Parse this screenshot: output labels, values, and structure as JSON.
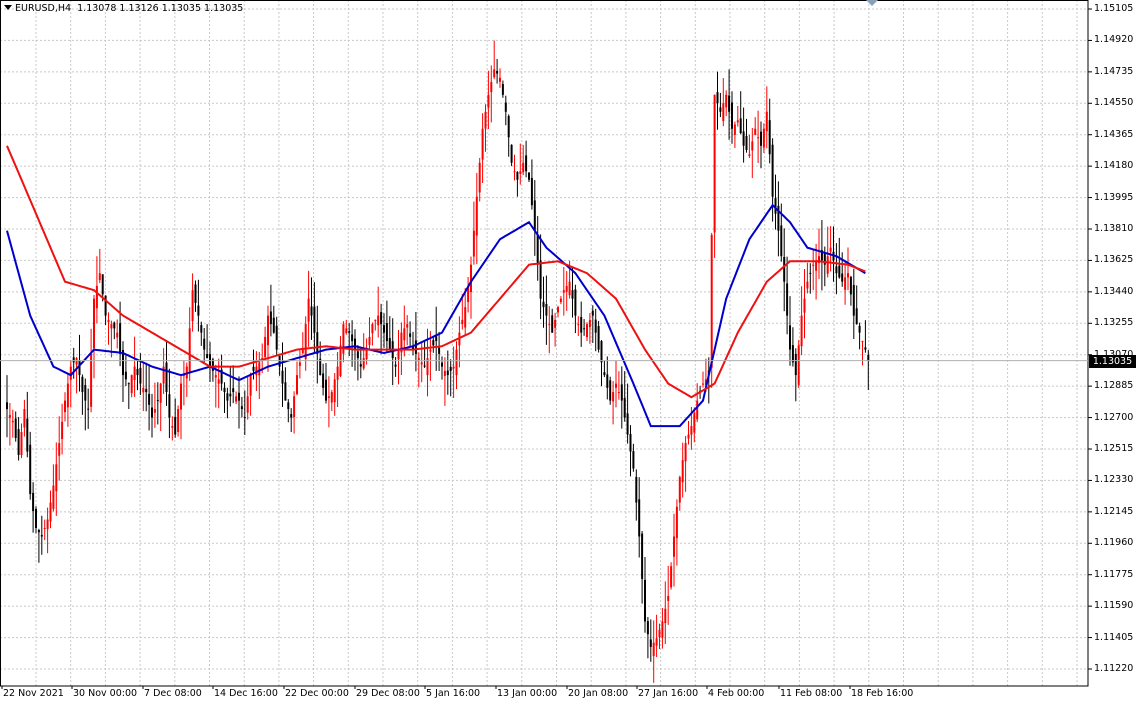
{
  "header": {
    "symbol": "EURUSD,H4",
    "prices": "1.13078 1.13126 1.13035 1.13035"
  },
  "price_axis": {
    "labels": [
      "1.15105",
      "1.14920",
      "1.14735",
      "1.14550",
      "1.14365",
      "1.14180",
      "1.13995",
      "1.13810",
      "1.13625",
      "1.13440",
      "1.13255",
      "1.13070",
      "1.12885",
      "1.12700",
      "1.12515",
      "1.12330",
      "1.12145",
      "1.11960",
      "1.11775",
      "1.11590",
      "1.11405",
      "1.11220"
    ],
    "current_price": "1.13035"
  },
  "time_axis": {
    "labels": [
      "22 Nov 2021",
      "30 Nov 00:00",
      "7 Dec 08:00",
      "14 Dec 16:00",
      "22 Dec 00:00",
      "29 Dec 08:00",
      "5 Jan 16:00",
      "13 Jan 00:00",
      "20 Jan 08:00",
      "27 Jan 16:00",
      "4 Feb 00:00",
      "11 Feb 08:00",
      "18 Feb 16:00"
    ]
  },
  "colors": {
    "bull_candle": "#ff0000",
    "bear_candle": "#000000",
    "fast_ma": "#0000cc",
    "slow_ma": "#ee1111",
    "grid": "#c8c8c8"
  },
  "chart_data": {
    "type": "candlestick",
    "symbol": "EURUSD",
    "timeframe": "H4",
    "ylim": [
      1.1122,
      1.15105
    ],
    "close_path": [
      [
        0,
        1.1275
      ],
      [
        2,
        1.1268
      ],
      [
        4,
        1.1248
      ],
      [
        6,
        1.1275
      ],
      [
        8,
        1.1225
      ],
      [
        10,
        1.1205
      ],
      [
        12,
        1.12
      ],
      [
        14,
        1.121
      ],
      [
        16,
        1.123
      ],
      [
        18,
        1.1255
      ],
      [
        20,
        1.128
      ],
      [
        22,
        1.13
      ],
      [
        24,
        1.1305
      ],
      [
        26,
        1.1285
      ],
      [
        28,
        1.1275
      ],
      [
        30,
        1.134
      ],
      [
        32,
        1.1355
      ],
      [
        34,
        1.133
      ],
      [
        36,
        1.1325
      ],
      [
        38,
        1.132
      ],
      [
        40,
        1.1295
      ],
      [
        42,
        1.129
      ],
      [
        44,
        1.13
      ],
      [
        46,
        1.129
      ],
      [
        48,
        1.1285
      ],
      [
        50,
        1.127
      ],
      [
        52,
        1.128
      ],
      [
        54,
        1.13
      ],
      [
        56,
        1.127
      ],
      [
        58,
        1.126
      ],
      [
        60,
        1.129
      ],
      [
        62,
        1.13
      ],
      [
        64,
        1.1345
      ],
      [
        66,
        1.133
      ],
      [
        68,
        1.131
      ],
      [
        70,
        1.13
      ],
      [
        72,
        1.1295
      ],
      [
        74,
        1.129
      ],
      [
        76,
        1.128
      ],
      [
        78,
        1.1285
      ],
      [
        80,
        1.128
      ],
      [
        82,
        1.127
      ],
      [
        84,
        1.1295
      ],
      [
        86,
        1.13
      ],
      [
        88,
        1.1305
      ],
      [
        90,
        1.133
      ],
      [
        92,
        1.132
      ],
      [
        94,
        1.13
      ],
      [
        96,
        1.128
      ],
      [
        98,
        1.127
      ],
      [
        100,
        1.1295
      ],
      [
        102,
        1.131
      ],
      [
        104,
        1.134
      ],
      [
        106,
        1.132
      ],
      [
        108,
        1.1295
      ],
      [
        110,
        1.128
      ],
      [
        112,
        1.1285
      ],
      [
        114,
        1.13
      ],
      [
        116,
        1.1325
      ],
      [
        118,
        1.132
      ],
      [
        120,
        1.131
      ],
      [
        122,
        1.13
      ],
      [
        124,
        1.131
      ],
      [
        126,
        1.1325
      ],
      [
        128,
        1.133
      ],
      [
        130,
        1.132
      ],
      [
        132,
        1.131
      ],
      [
        134,
        1.13
      ],
      [
        136,
        1.132
      ],
      [
        138,
        1.1325
      ],
      [
        140,
        1.131
      ],
      [
        142,
        1.1305
      ],
      [
        144,
        1.13
      ],
      [
        146,
        1.131
      ],
      [
        148,
        1.1315
      ],
      [
        150,
        1.13
      ],
      [
        152,
        1.1295
      ],
      [
        154,
        1.13
      ],
      [
        156,
        1.132
      ],
      [
        158,
        1.1335
      ],
      [
        160,
        1.136
      ],
      [
        162,
        1.14
      ],
      [
        164,
        1.144
      ],
      [
        166,
        1.146
      ],
      [
        168,
        1.1475
      ],
      [
        170,
        1.147
      ],
      [
        172,
        1.145
      ],
      [
        174,
        1.142
      ],
      [
        176,
        1.141
      ],
      [
        178,
        1.142
      ],
      [
        180,
        1.141
      ],
      [
        182,
        1.138
      ],
      [
        184,
        1.134
      ],
      [
        186,
        1.133
      ],
      [
        188,
        1.132
      ],
      [
        190,
        1.1335
      ],
      [
        192,
        1.1345
      ],
      [
        194,
        1.135
      ],
      [
        196,
        1.133
      ],
      [
        198,
        1.132
      ],
      [
        200,
        1.1325
      ],
      [
        202,
        1.133
      ],
      [
        204,
        1.131
      ],
      [
        206,
        1.1295
      ],
      [
        208,
        1.128
      ],
      [
        210,
        1.129
      ],
      [
        212,
        1.128
      ],
      [
        214,
        1.126
      ],
      [
        216,
        1.124
      ],
      [
        218,
        1.12
      ],
      [
        220,
        1.115
      ],
      [
        222,
        1.1135
      ],
      [
        224,
        1.114
      ],
      [
        226,
        1.115
      ],
      [
        228,
        1.1165
      ],
      [
        230,
        1.12
      ],
      [
        232,
        1.1235
      ],
      [
        234,
        1.1255
      ],
      [
        236,
        1.1265
      ],
      [
        238,
        1.128
      ],
      [
        240,
        1.129
      ],
      [
        242,
        1.1295
      ],
      [
        244,
        1.146
      ],
      [
        246,
        1.145
      ],
      [
        248,
        1.146
      ],
      [
        250,
        1.144
      ],
      [
        252,
        1.1445
      ],
      [
        254,
        1.143
      ],
      [
        256,
        1.1425
      ],
      [
        258,
        1.144
      ],
      [
        260,
        1.143
      ],
      [
        262,
        1.145
      ],
      [
        264,
        1.14
      ],
      [
        266,
        1.138
      ],
      [
        268,
        1.135
      ],
      [
        270,
        1.131
      ],
      [
        272,
        1.1295
      ],
      [
        274,
        1.133
      ],
      [
        276,
        1.135
      ],
      [
        278,
        1.136
      ],
      [
        280,
        1.1365
      ],
      [
        282,
        1.136
      ],
      [
        284,
        1.137
      ],
      [
        286,
        1.1355
      ],
      [
        288,
        1.135
      ],
      [
        290,
        1.1355
      ],
      [
        292,
        1.133
      ],
      [
        294,
        1.132
      ],
      [
        296,
        1.131
      ],
      [
        297,
        1.13035
      ]
    ],
    "moving_averages": [
      {
        "color": "#0000cc",
        "path": [
          [
            0,
            1.138
          ],
          [
            8,
            1.133
          ],
          [
            16,
            1.13
          ],
          [
            22,
            1.1295
          ],
          [
            30,
            1.131
          ],
          [
            40,
            1.1308
          ],
          [
            50,
            1.13
          ],
          [
            60,
            1.1295
          ],
          [
            70,
            1.13
          ],
          [
            80,
            1.1292
          ],
          [
            90,
            1.13
          ],
          [
            100,
            1.1305
          ],
          [
            110,
            1.131
          ],
          [
            120,
            1.1312
          ],
          [
            130,
            1.1308
          ],
          [
            140,
            1.1312
          ],
          [
            150,
            1.132
          ],
          [
            160,
            1.135
          ],
          [
            170,
            1.1375
          ],
          [
            180,
            1.1385
          ],
          [
            186,
            1.137
          ],
          [
            196,
            1.1355
          ],
          [
            206,
            1.133
          ],
          [
            216,
            1.129
          ],
          [
            222,
            1.1265
          ],
          [
            232,
            1.1265
          ],
          [
            240,
            1.128
          ],
          [
            248,
            1.134
          ],
          [
            256,
            1.1375
          ],
          [
            264,
            1.1395
          ],
          [
            270,
            1.1385
          ],
          [
            276,
            1.137
          ],
          [
            286,
            1.1365
          ],
          [
            296,
            1.1355
          ]
        ]
      },
      {
        "color": "#ee1111",
        "path": [
          [
            0,
            1.143
          ],
          [
            10,
            1.139
          ],
          [
            20,
            1.135
          ],
          [
            30,
            1.1345
          ],
          [
            40,
            1.133
          ],
          [
            50,
            1.132
          ],
          [
            60,
            1.131
          ],
          [
            70,
            1.13
          ],
          [
            80,
            1.13
          ],
          [
            90,
            1.1305
          ],
          [
            100,
            1.131
          ],
          [
            110,
            1.1312
          ],
          [
            120,
            1.131
          ],
          [
            130,
            1.131
          ],
          [
            140,
            1.131
          ],
          [
            150,
            1.1312
          ],
          [
            160,
            1.132
          ],
          [
            170,
            1.134
          ],
          [
            180,
            1.136
          ],
          [
            190,
            1.1362
          ],
          [
            200,
            1.1355
          ],
          [
            210,
            1.134
          ],
          [
            220,
            1.131
          ],
          [
            228,
            1.129
          ],
          [
            236,
            1.1282
          ],
          [
            244,
            1.129
          ],
          [
            252,
            1.132
          ],
          [
            262,
            1.135
          ],
          [
            270,
            1.1362
          ],
          [
            280,
            1.1362
          ],
          [
            290,
            1.136
          ],
          [
            296,
            1.1356
          ]
        ]
      }
    ]
  }
}
